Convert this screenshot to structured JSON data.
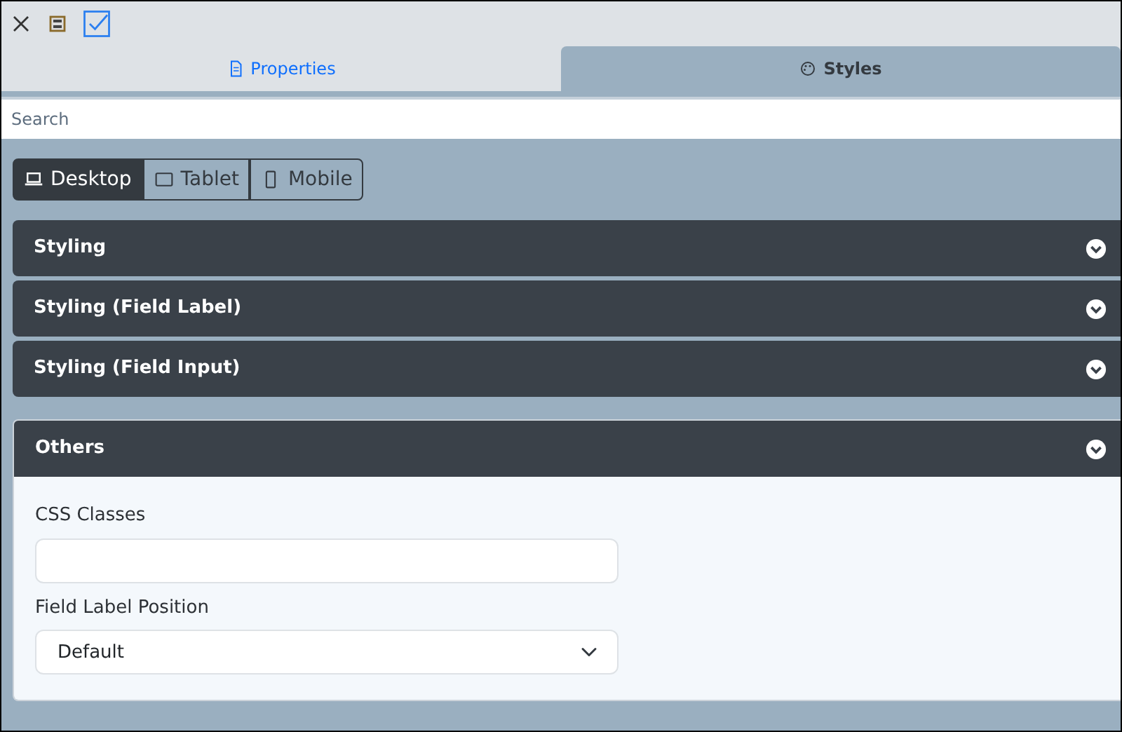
{
  "tabs": [
    {
      "label": "Properties",
      "kind": "document",
      "selected": false
    },
    {
      "label": "Styles",
      "kind": "palette",
      "selected": true
    }
  ],
  "search": {
    "placeholder": "Search"
  },
  "devices": [
    {
      "label": "Desktop",
      "kind": "laptop",
      "selected": true
    },
    {
      "label": "Tablet",
      "kind": "tablet",
      "selected": false
    },
    {
      "label": "Mobile",
      "kind": "phone",
      "selected": false
    }
  ],
  "sections": [
    {
      "title": "Styling",
      "expanded": false
    },
    {
      "title": "Styling (Field Label)",
      "expanded": false
    },
    {
      "title": "Styling (Field Input)",
      "expanded": false
    },
    {
      "title": "Others",
      "expanded": true,
      "fields": [
        {
          "kind": "text",
          "label": "CSS Classes"
        },
        {
          "kind": "select",
          "label": "Field Label Position",
          "value": "Default"
        }
      ]
    }
  ]
}
